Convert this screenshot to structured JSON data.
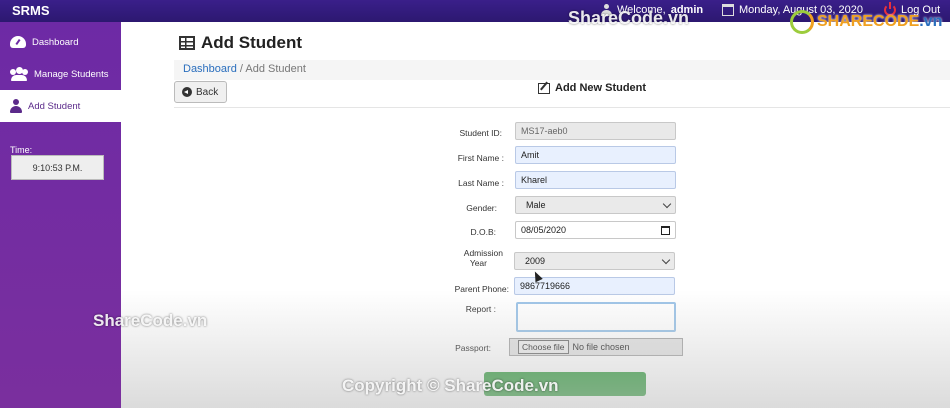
{
  "topbar": {
    "brand": "SRMS",
    "welcome_label": "Welcome,",
    "username": "admin",
    "date": "Monday, August 03, 2020",
    "logout": "Log Out"
  },
  "sidebar": {
    "items": [
      {
        "label": "Dashboard",
        "icon": "dashboard-icon"
      },
      {
        "label": "Manage Students",
        "icon": "users-icon"
      },
      {
        "label": "Add Student",
        "icon": "user-icon",
        "active": true
      }
    ],
    "time_label": "Time:",
    "time_value": "9:10:53 P.M."
  },
  "main": {
    "title": "Add Student",
    "breadcrumb": {
      "home": "Dashboard",
      "separator": "/",
      "current": "Add Student"
    },
    "back_label": "Back",
    "form_title": "Add New Student"
  },
  "form": {
    "student_id": {
      "label": "Student ID:",
      "value": "MS17-aeb0"
    },
    "first_name": {
      "label": "First Name :",
      "value": "Amit"
    },
    "last_name": {
      "label": "Last Name :",
      "value": "Kharel"
    },
    "gender": {
      "label": "Gender:",
      "value": "Male"
    },
    "dob": {
      "label": "D.O.B:",
      "value": "08/05/2020"
    },
    "admission_year": {
      "label_line1": "Admission",
      "label_line2": "Year",
      "value": "2009"
    },
    "parent_phone": {
      "label": "Parent Phone:",
      "value": "9867719666"
    },
    "report": {
      "label": "Report :",
      "value": ""
    },
    "passport": {
      "label": "Passport:",
      "button": "Choose file",
      "status": "No file chosen"
    }
  },
  "watermarks": {
    "top": "ShareCode.vn",
    "logo": "SHARECODE",
    "logo_suffix": ".vn",
    "left": "ShareCode.vn",
    "bottom": "Copyright © ShareCode.vn"
  },
  "colors": {
    "topbar": "#2c1870",
    "sidebar": "#6d2aa5",
    "submit": "#3fa24a",
    "link": "#2a6ebd"
  }
}
